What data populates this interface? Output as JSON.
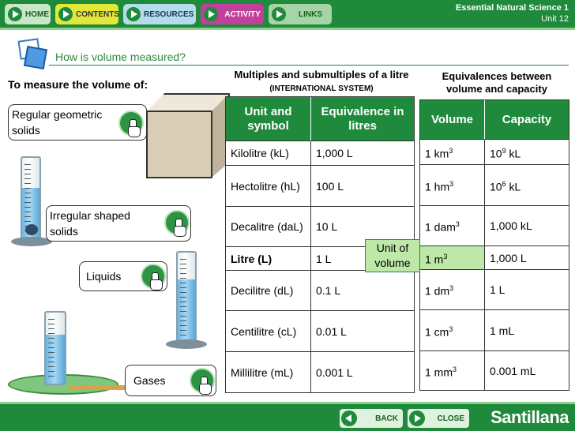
{
  "nav": {
    "home": "HOME",
    "contents": "CONTENTS",
    "resources": "RESOURCES",
    "activity": "ACTIVITY",
    "links": "LINKS"
  },
  "course": {
    "title": "Essential Natural Science 1",
    "unit": "Unit 12"
  },
  "page": {
    "question": "How is volume measured?",
    "measure_heading": "To measure the volume of:"
  },
  "items": {
    "regular": "Regular geometric solids",
    "irregular": "Irregular shaped solids",
    "liquids": "Liquids",
    "gases": "Gases"
  },
  "litre_table": {
    "title": "Multiples and submultiples of a litre",
    "subtitle": "(INTERNATIONAL SYSTEM)",
    "headers": [
      "Unit and symbol",
      "Equivalence in litres"
    ],
    "rows": [
      [
        "Kilolitre (kL)",
        "1,000 L"
      ],
      [
        "Hectolitre (hL)",
        "100 L"
      ],
      [
        "Decalitre (daL)",
        "10 L"
      ],
      [
        "Litre (L)",
        "1 L"
      ],
      [
        "Decilitre (dL)",
        "0.1 L"
      ],
      [
        "Centilitre (cL)",
        "0.01 L"
      ],
      [
        "Millilitre (mL)",
        "0.001 L"
      ]
    ]
  },
  "equiv_table": {
    "title": "Equivalences between volume and capacity",
    "headers": [
      "Volume",
      "Capacity"
    ],
    "rows": [
      {
        "base": "1 km",
        "exp": "3",
        "cap_base": "10",
        "cap_exp": "9",
        "cap_unit": " kL"
      },
      {
        "base": "1 hm",
        "exp": "3",
        "cap_base": "10",
        "cap_exp": "6",
        "cap_unit": " kL"
      },
      {
        "base": "1 dam",
        "exp": "3",
        "cap_base": "1,000 kL",
        "cap_exp": "",
        "cap_unit": ""
      },
      {
        "base": "1 m",
        "exp": "3",
        "cap_base": "1,000 L",
        "cap_exp": "",
        "cap_unit": ""
      },
      {
        "base": "1 dm",
        "exp": "3",
        "cap_base": "1 L",
        "cap_exp": "",
        "cap_unit": ""
      },
      {
        "base": "1 cm",
        "exp": "3",
        "cap_base": "1 mL",
        "cap_exp": "",
        "cap_unit": ""
      },
      {
        "base": "1 mm",
        "exp": "3",
        "cap_base": "0.001 mL",
        "cap_exp": "",
        "cap_unit": ""
      }
    ]
  },
  "unit_note": "Unit of volume",
  "footer": {
    "back": "BACK",
    "close": "CLOSE",
    "brand": "Santillana"
  }
}
